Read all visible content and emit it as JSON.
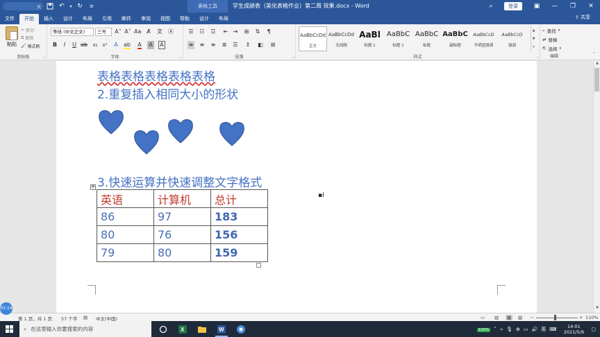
{
  "titlebar": {
    "autosave_label": "关",
    "context_tab": "表格工具",
    "doc_title": "学生成绩表（美化表格作业）第二周 效果.docx - Word",
    "login_label": "登录"
  },
  "tabs": [
    {
      "label": "文件"
    },
    {
      "label": "开始"
    },
    {
      "label": "插入"
    },
    {
      "label": "设计"
    },
    {
      "label": "布局"
    },
    {
      "label": "引用"
    },
    {
      "label": "邮件"
    },
    {
      "label": "审阅"
    },
    {
      "label": "视图"
    },
    {
      "label": "帮助"
    },
    {
      "label": "设计"
    },
    {
      "label": "布局"
    }
  ],
  "share_label": "共享",
  "ribbon": {
    "clipboard": {
      "paste": "粘贴",
      "cut": "剪切",
      "copy": "复制",
      "format_painter": "格式刷",
      "group_label": "剪贴板"
    },
    "font": {
      "font_name": "等线 (中文正文)",
      "font_size": "三号",
      "group_label": "字体"
    },
    "paragraph": {
      "group_label": "段落"
    },
    "styles": {
      "group_label": "样式",
      "items": [
        {
          "preview": "AaBbCcDd",
          "name": "正文",
          "kind": "normal"
        },
        {
          "preview": "AaBbCcDd",
          "name": "无间隔",
          "kind": "normal"
        },
        {
          "preview": "AaBl",
          "name": "标题 1",
          "kind": "big"
        },
        {
          "preview": "AaBbC",
          "name": "标题 2",
          "kind": "med"
        },
        {
          "preview": "AaBbC",
          "name": "标题",
          "kind": "med"
        },
        {
          "preview": "AaBbC",
          "name": "副标题",
          "kind": "medbold"
        },
        {
          "preview": "AaBbCcD",
          "name": "不明显强调",
          "kind": "it"
        },
        {
          "preview": "AaBbCcD",
          "name": "强调",
          "kind": "it"
        }
      ]
    },
    "editing": {
      "find": "查找",
      "replace": "替换",
      "select": "选择",
      "group_label": "编辑"
    }
  },
  "document": {
    "line1": "表格表格表格表格表格",
    "heading2": "2.重复插入相同大小的形状",
    "heading3": "3.快速运算并快速调整文字格式",
    "table": {
      "header": [
        "英语",
        "计算机",
        "总计"
      ],
      "rows": [
        [
          "86",
          "97",
          "183"
        ],
        [
          "80",
          "76",
          "156"
        ],
        [
          "79",
          "80",
          "159"
        ]
      ]
    },
    "heart_color": "#4472c4"
  },
  "statusbar": {
    "page": "第 1 页，共 1 页",
    "words": "57 个字",
    "language": "中文(中国)",
    "zoom": "110%"
  },
  "taskbar": {
    "search_placeholder": "在这里输入你要搜索的内容",
    "battery": "100%",
    "ime": "英",
    "time": "14:01",
    "date": "2021/5/9"
  },
  "overlay": {
    "timer": "01:14"
  }
}
